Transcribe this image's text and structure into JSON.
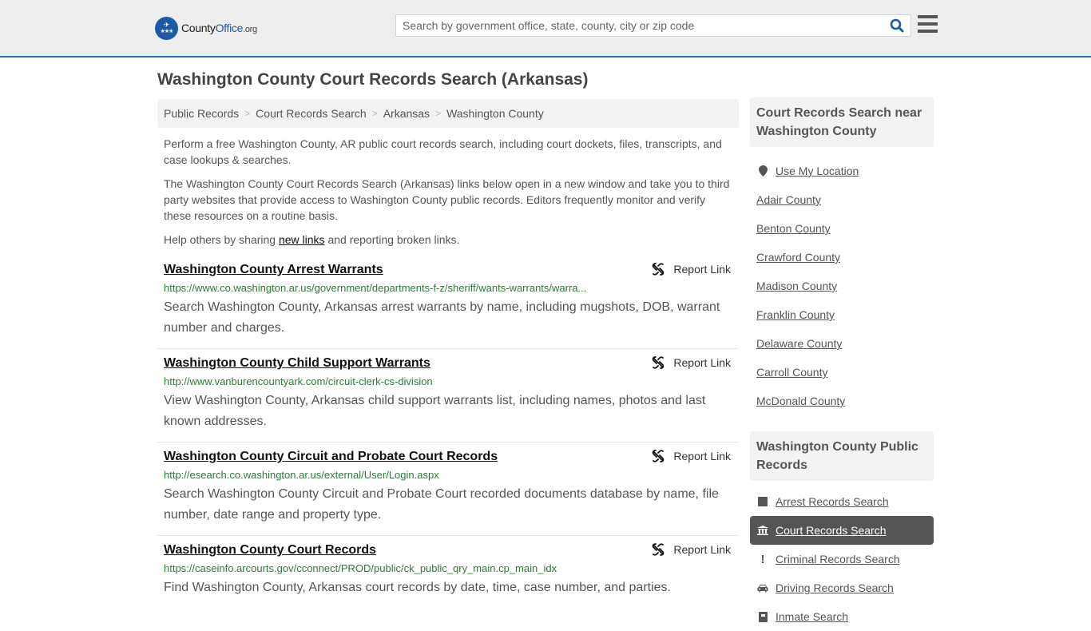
{
  "header": {
    "logo": {
      "part1": "County",
      "part2": "Office",
      "part3": ".org"
    },
    "search_placeholder": "Search by government office, state, county, city or zip code",
    "search_icon": "search-icon",
    "menu_icon": "hamburger-menu-icon"
  },
  "page": {
    "title": "Washington County Court Records Search (Arkansas)"
  },
  "breadcrumb": [
    "Public Records",
    "Court Records Search",
    "Arkansas",
    "Washington County"
  ],
  "intro": {
    "p1": "Perform a free Washington County, AR public court records search, including court dockets, files, transcripts, and case lookups & searches.",
    "p2": "The Washington County Court Records Search (Arkansas) links below open in a new window and take you to third party websites that provide access to Washington County public records. Editors frequently monitor and verify these resources on a routine basis.",
    "p3_before": "Help others by sharing ",
    "p3_link": "new links",
    "p3_after": " and reporting broken links."
  },
  "results": [
    {
      "title": "Washington County Arrest Warrants",
      "url": "https://www.co.washington.ar.us/government/departments-f-z/sheriff/wants-warrants/warra...",
      "description": "Search Washington County, Arkansas arrest warrants by name, including mugshots, DOB, warrant number and charges.",
      "report_label": "Report Link"
    },
    {
      "title": "Washington County Child Support Warrants",
      "url": "http://www.vanburencountyark.com/circuit-clerk-cs-division",
      "description": "View Washington County, Arkansas child support warrants list, including names, photos and last known addresses.",
      "report_label": "Report Link"
    },
    {
      "title": "Washington County Circuit and Probate Court Records",
      "url": "http://esearch.co.washington.ar.us/external/User/Login.aspx",
      "description": "Search Washington County Circuit and Probate Court recorded documents database by name, file number, date range and property type.",
      "report_label": "Report Link"
    },
    {
      "title": "Washington County Court Records",
      "url": "https://caseinfo.arcourts.gov/cconnect/PROD/public/ck_public_qry_main.cp_main_idx",
      "description": "Find Washington County, Arkansas court records by date, time, case number, and parties.",
      "report_label": "Report Link"
    }
  ],
  "sidebar": {
    "nearby": {
      "heading": "Court Records Search near Washington County",
      "use_location": "Use My Location",
      "counties": [
        "Adair County",
        "Benton County",
        "Crawford County",
        "Madison County",
        "Franklin County",
        "Delaware County",
        "Carroll County",
        "McDonald County"
      ]
    },
    "public_records": {
      "heading": "Washington County Public Records",
      "items": [
        {
          "label": "Arrest Records Search",
          "icon": "square-icon",
          "active": false
        },
        {
          "label": "Court Records Search",
          "icon": "courthouse-icon",
          "active": true
        },
        {
          "label": "Criminal Records Search",
          "icon": "exclamation-icon",
          "active": false
        },
        {
          "label": "Driving Records Search",
          "icon": "car-icon",
          "active": false
        },
        {
          "label": "Inmate Search",
          "icon": "id-badge-icon",
          "active": false
        }
      ]
    }
  },
  "colors": {
    "header_bg": "#eeeeee",
    "header_border": "#2b72b3",
    "brand_blue": "#1b5aa6",
    "url_green": "#2f7a3b",
    "active_item_bg": "#555555"
  }
}
